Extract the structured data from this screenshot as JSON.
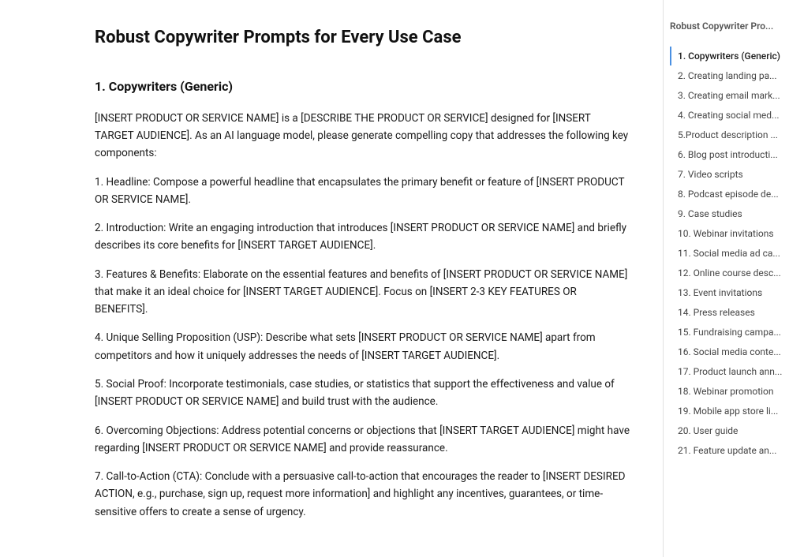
{
  "page": {
    "title": "Robust Copywriter Prompts for Every Use Case"
  },
  "main": {
    "section_heading": "1. Copywriters (Generic)",
    "paragraphs": [
      "[INSERT PRODUCT OR SERVICE NAME] is a [DESCRIBE THE PRODUCT OR SERVICE] designed for [INSERT TARGET AUDIENCE]. As an AI language model, please generate compelling copy that addresses the following key components:",
      "1. Headline: Compose a powerful headline that encapsulates the primary benefit or feature of [INSERT PRODUCT OR SERVICE NAME].",
      "2. Introduction: Write an engaging introduction that introduces [INSERT PRODUCT OR SERVICE NAME] and briefly describes its core benefits for [INSERT TARGET AUDIENCE].",
      "3. Features & Benefits: Elaborate on the essential features and benefits of [INSERT PRODUCT OR SERVICE NAME] that make it an ideal choice for [INSERT TARGET AUDIENCE]. Focus on [INSERT 2-3 KEY FEATURES OR BENEFITS].",
      "4. Unique Selling Proposition (USP): Describe what sets [INSERT PRODUCT OR SERVICE NAME] apart from competitors and how it uniquely addresses the needs of [INSERT TARGET AUDIENCE].",
      "5. Social Proof: Incorporate testimonials, case studies, or statistics that support the effectiveness and value of [INSERT PRODUCT OR SERVICE NAME] and build trust with the audience.",
      "6. Overcoming Objections: Address potential concerns or objections that [INSERT TARGET AUDIENCE] might have regarding [INSERT PRODUCT OR SERVICE NAME] and provide reassurance.",
      "7. Call-to-Action (CTA): Conclude with a persuasive call-to-action that encourages the reader to [INSERT DESIRED ACTION, e.g., purchase, sign up, request more information] and highlight any incentives, guarantees, or time-sensitive offers to create a sense of urgency."
    ]
  },
  "sidebar": {
    "title": "Robust Copywriter Pro...",
    "items": [
      {
        "label": "1. Copywriters (Generic)",
        "active": true
      },
      {
        "label": "2. Creating landing pa...",
        "active": false
      },
      {
        "label": "3. Creating email mark...",
        "active": false
      },
      {
        "label": "4. Creating social med...",
        "active": false
      },
      {
        "label": "5.Product description ...",
        "active": false
      },
      {
        "label": "6. Blog post introducti...",
        "active": false
      },
      {
        "label": "7. Video scripts",
        "active": false
      },
      {
        "label": "8. Podcast episode de...",
        "active": false
      },
      {
        "label": "9. Case studies",
        "active": false
      },
      {
        "label": "10. Webinar invitations",
        "active": false
      },
      {
        "label": "11. Social media ad ca...",
        "active": false
      },
      {
        "label": "12. Online course desc...",
        "active": false
      },
      {
        "label": "13. Event invitations",
        "active": false
      },
      {
        "label": "14. Press releases",
        "active": false
      },
      {
        "label": "15. Fundraising campa...",
        "active": false
      },
      {
        "label": "16. Social media conte...",
        "active": false
      },
      {
        "label": "17. Product launch ann...",
        "active": false
      },
      {
        "label": "18. Webinar promotion",
        "active": false
      },
      {
        "label": "19. Mobile app store li...",
        "active": false
      },
      {
        "label": "20. User guide",
        "active": false
      },
      {
        "label": "21. Feature update an...",
        "active": false
      }
    ]
  }
}
